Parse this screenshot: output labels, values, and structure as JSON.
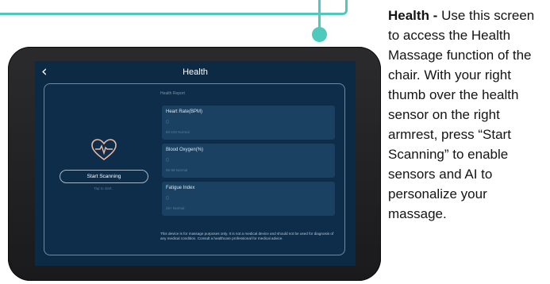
{
  "screen": {
    "title": "Health",
    "back_icon": "chevron-left-icon",
    "section_label": "Health Report",
    "heart_icon": "heart-pulse-icon",
    "start_button_label": "Start Scanning",
    "tap_hint": "Tap to start.",
    "metrics": [
      {
        "name": "Heart Rate(BPM)",
        "value": "0",
        "range": "60-100 Normal"
      },
      {
        "name": "Blood Oxygen(%)",
        "value": "0",
        "range": "95-99 Normal"
      },
      {
        "name": "Fatigue Index",
        "value": "0",
        "range": "25+ Normal"
      }
    ],
    "disclaimer": "This device is for massage purposes only. It is not a medical device and should not be used for diagnosis of any medical condition. Consult a healthcare professional for medical advice."
  },
  "description": {
    "heading": "Health -",
    "text": "Use this screen to access the Health Massage function of the chair. With your right thumb over the health sensor on the right armrest, press “Start Scanning” to enable sensors and AI to personalize your massage."
  },
  "colors": {
    "accent": "#4fc9bb",
    "screen_bg": "#0d2a45",
    "card_bg": "#1b4162",
    "heart": "#e9b9a3"
  }
}
